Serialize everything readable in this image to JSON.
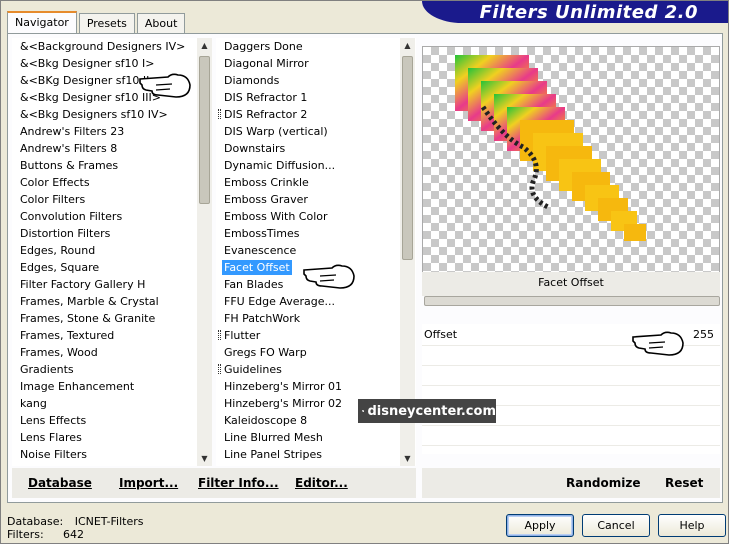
{
  "app": {
    "title": "Filters Unlimited 2.0"
  },
  "tabs": [
    {
      "label": "Navigator",
      "active": true
    },
    {
      "label": "Presets",
      "active": false
    },
    {
      "label": "About",
      "active": false
    }
  ],
  "categories": [
    "&<Background Designers IV>",
    "&<Bkg Designer sf10 I>",
    "&<BKg Designer sf10 II>",
    "&<Bkg Designer sf10 III>",
    "&<Bkg Designers sf10 IV>",
    "Andrew's Filters 23",
    "Andrew's Filters 8",
    "Buttons & Frames",
    "Color Effects",
    "Color Filters",
    "Convolution Filters",
    "Distortion Filters",
    "Edges, Round",
    "Edges, Square",
    "Filter Factory Gallery H",
    "Frames, Marble & Crystal",
    "Frames, Stone & Granite",
    "Frames, Textured",
    "Frames, Wood",
    "Gradients",
    "Image Enhancement",
    "kang",
    "Lens Effects",
    "Lens Flares",
    "Noise Filters"
  ],
  "filters": [
    {
      "label": "Daggers Done",
      "marked": false,
      "selected": false
    },
    {
      "label": "Diagonal Mirror",
      "marked": false,
      "selected": false
    },
    {
      "label": "Diamonds",
      "marked": false,
      "selected": false
    },
    {
      "label": "DIS Refractor 1",
      "marked": false,
      "selected": false
    },
    {
      "label": "DIS Refractor 2",
      "marked": true,
      "selected": false
    },
    {
      "label": "DIS Warp (vertical)",
      "marked": false,
      "selected": false
    },
    {
      "label": "Downstairs",
      "marked": false,
      "selected": false
    },
    {
      "label": "Dynamic Diffusion...",
      "marked": false,
      "selected": false
    },
    {
      "label": "Emboss Crinkle",
      "marked": false,
      "selected": false
    },
    {
      "label": "Emboss Graver",
      "marked": false,
      "selected": false
    },
    {
      "label": "Emboss With Color",
      "marked": false,
      "selected": false
    },
    {
      "label": "EmbossTimes",
      "marked": false,
      "selected": false
    },
    {
      "label": "Evanescence",
      "marked": false,
      "selected": false
    },
    {
      "label": "Facet Offset",
      "marked": false,
      "selected": true
    },
    {
      "label": "Fan Blades",
      "marked": false,
      "selected": false
    },
    {
      "label": "FFU Edge Average...",
      "marked": false,
      "selected": false
    },
    {
      "label": "FH PatchWork",
      "marked": false,
      "selected": false
    },
    {
      "label": "Flutter",
      "marked": true,
      "selected": false
    },
    {
      "label": "Gregs FO Warp",
      "marked": false,
      "selected": false
    },
    {
      "label": "Guidelines",
      "marked": true,
      "selected": false
    },
    {
      "label": "Hinzeberg's Mirror 01",
      "marked": false,
      "selected": false
    },
    {
      "label": "Hinzeberg's Mirror 02",
      "marked": false,
      "selected": false
    },
    {
      "label": "Kaleidoscope 8",
      "marked": false,
      "selected": false
    },
    {
      "label": "Line Blurred Mesh",
      "marked": false,
      "selected": false
    },
    {
      "label": "Line Panel Stripes",
      "marked": false,
      "selected": false
    }
  ],
  "preview": {
    "filter_name": "Facet Offset"
  },
  "params": [
    {
      "label": "Offset",
      "value": "255"
    }
  ],
  "toolbar": {
    "database": "Database",
    "import": "Import...",
    "filter_info": "Filter Info...",
    "editor": "Editor...",
    "randomize": "Randomize",
    "reset": "Reset"
  },
  "footer": {
    "database_label": "Database:",
    "database_value": "ICNET-Filters",
    "filters_label": "Filters:",
    "filters_value": "642"
  },
  "buttons": {
    "apply": "Apply",
    "cancel": "Cancel",
    "help": "Help"
  },
  "watermark": {
    "text": "disneycenter.com"
  },
  "colors": {
    "banner": "#1a1a8c",
    "selection": "#3399ff"
  }
}
